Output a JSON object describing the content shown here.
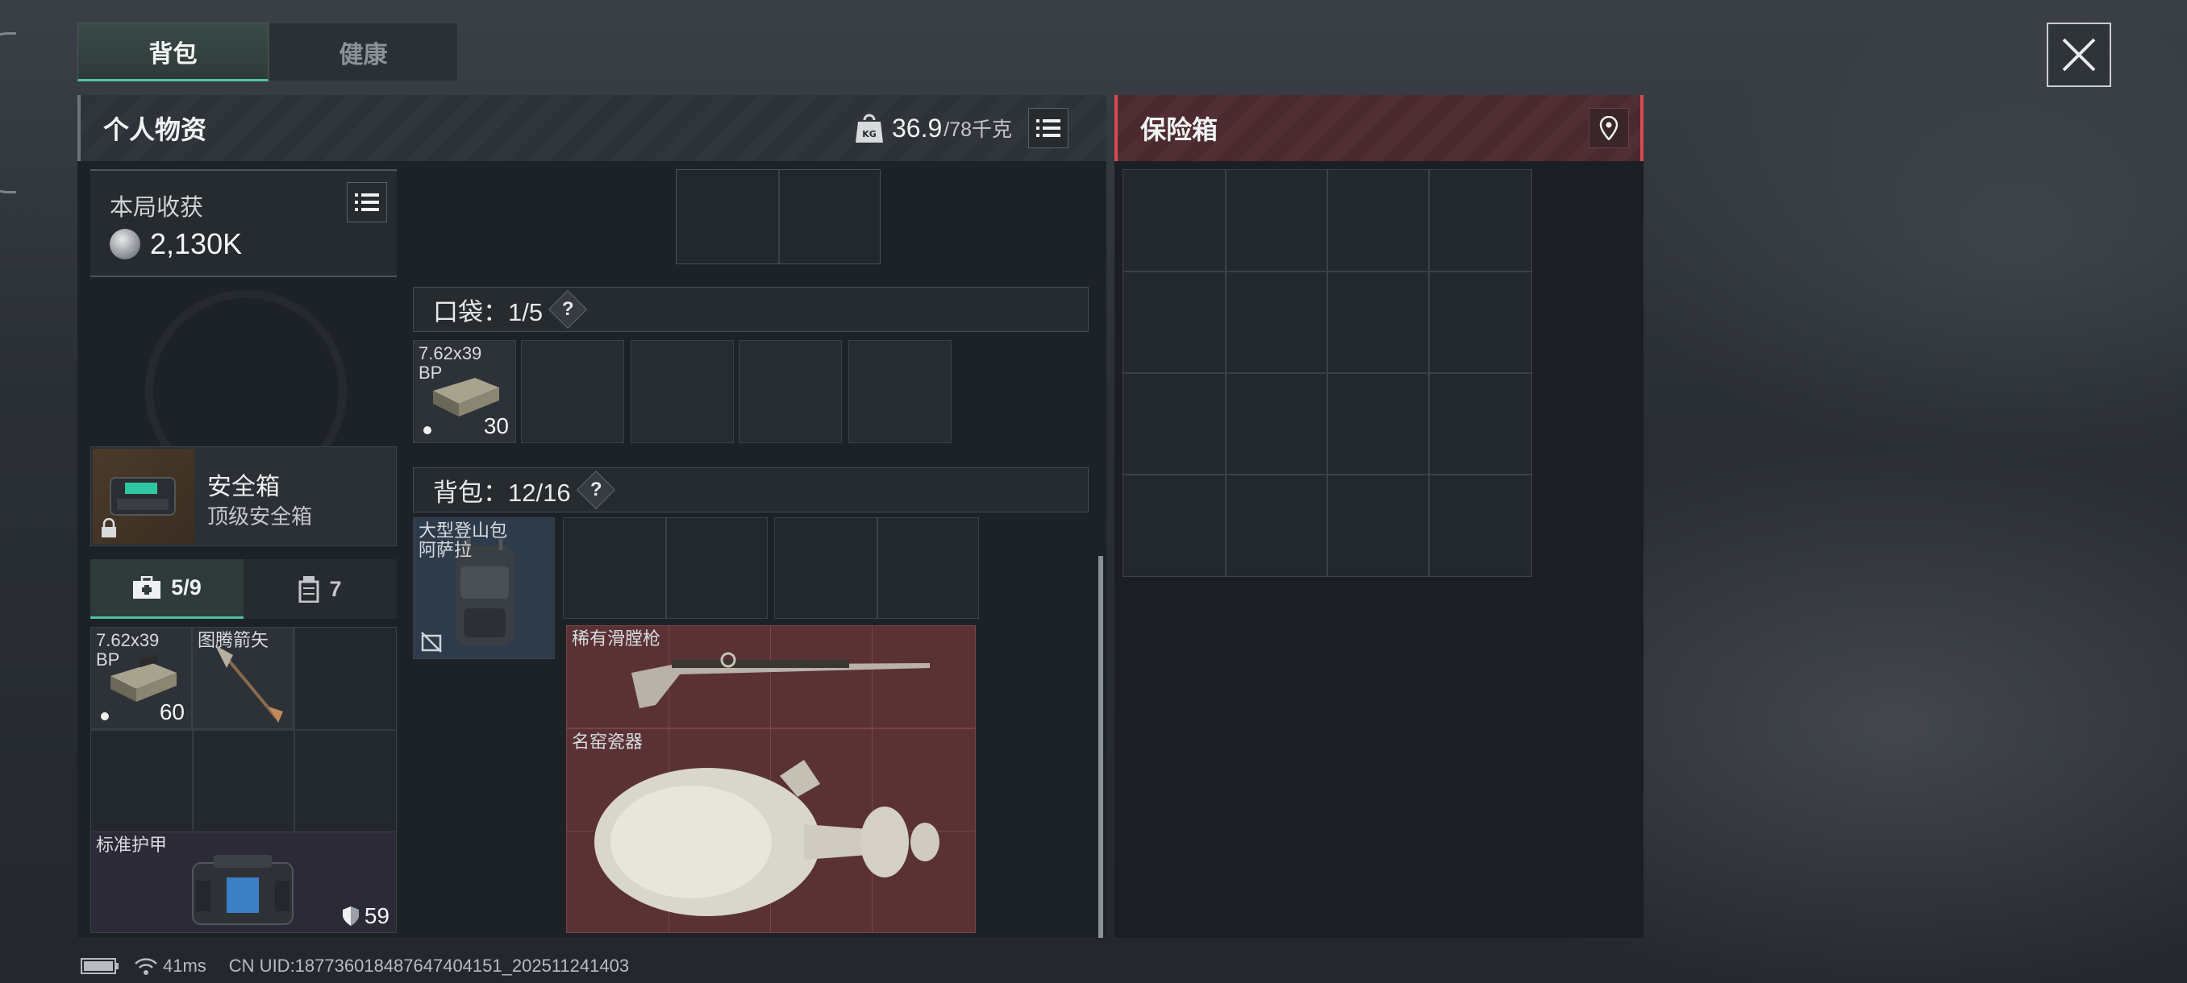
{
  "tabs": {
    "backpack": "背包",
    "health": "健康"
  },
  "header": {
    "title": "个人物资",
    "weight_current": "36.9",
    "weight_max": "/78千克",
    "kg_icon_text": "KG"
  },
  "safe_box_panel": {
    "title": "保险箱"
  },
  "harvest": {
    "label": "本局收获",
    "value": "2,130K"
  },
  "secure_container": {
    "title": "安全箱",
    "subtitle": "顶级安全箱"
  },
  "sub_tabs": {
    "medical_count": "5/9",
    "ammo_count": "7"
  },
  "left_items": {
    "ammo_label": "7.62x39\nBP",
    "ammo_count": "60",
    "arrow_label": "图腾箭矢",
    "armor_label": "标准护甲",
    "armor_value": "59"
  },
  "pockets": {
    "label": "口袋：1/5",
    "help": "?",
    "ammo_label": "7.62x39\nBP",
    "ammo_count": "30"
  },
  "backpack": {
    "label": "背包：12/16",
    "help": "?",
    "bag_label": "大型登山包\n阿萨拉",
    "musket_label": "稀有滑膛枪",
    "vase_label": "名窑瓷器"
  },
  "status": {
    "ping": "41ms",
    "uid": "CN UID:187736018487647404151_202511241403"
  },
  "colors": {
    "accent": "#4fc2a3",
    "danger": "#d84a4f",
    "valuable_bg": "#5a3235"
  }
}
